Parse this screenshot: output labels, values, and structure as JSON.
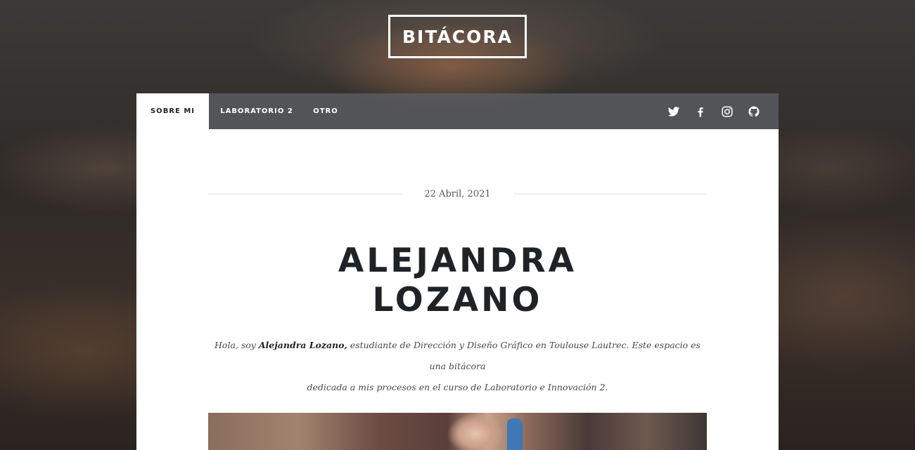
{
  "brand": {
    "title": "BITÁCORA"
  },
  "nav": {
    "items": [
      {
        "label": "SOBRE MI",
        "active": true
      },
      {
        "label": "LABORATORIO 2",
        "active": false
      },
      {
        "label": "OTRO",
        "active": false
      }
    ],
    "social": [
      "twitter-icon",
      "facebook-icon",
      "instagram-icon",
      "github-icon"
    ]
  },
  "post": {
    "date": "22 Abril, 2021",
    "name_line1": "ALEJANDRA",
    "name_line2": "LOZANO",
    "intro_prefix": "Hola, soy ",
    "intro_name": "Alejandra Lozano,",
    "intro_line1_rest": " estudiante de Dirección y Diseño Gráfico en Toulouse Lautrec. Este espacio es una bitácora",
    "intro_line2": "dedicada a mis procesos en el curso de Laboratorio e Innovación 2."
  },
  "colors": {
    "text_dark": "#1f2327",
    "nav_bg": "#5f6268",
    "card_bg": "#ffffff"
  }
}
